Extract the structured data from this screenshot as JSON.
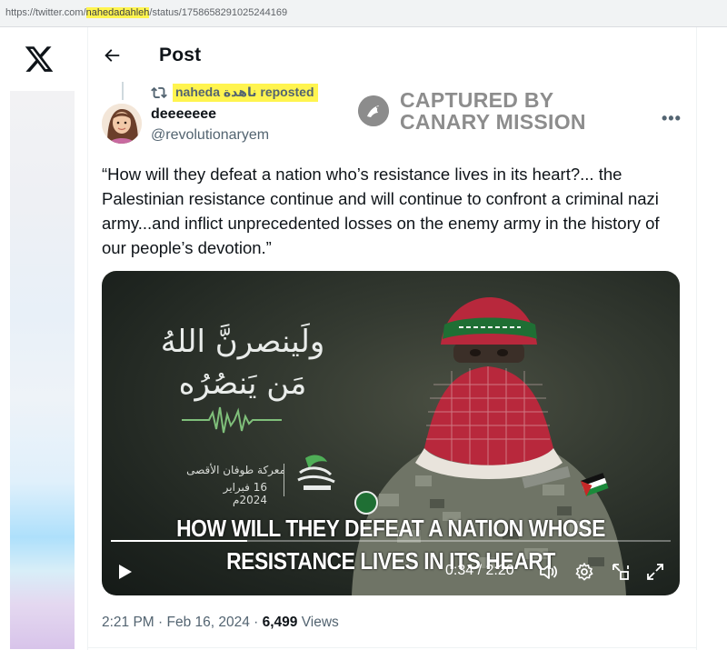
{
  "browser": {
    "url_prefix": "https://twitter.com/",
    "url_highlight": "nahedadahleh",
    "url_suffix": "/status/1758658291025244169"
  },
  "header": {
    "title": "Post"
  },
  "repost": {
    "label": "naheda ناهدة reposted"
  },
  "author": {
    "display_name": "deeeeeee",
    "handle": "@revolutionaryem"
  },
  "watermark": {
    "line1": "CAPTURED BY",
    "line2": "CANARY MISSION"
  },
  "tweet": {
    "text": "“How will they defeat a nation who’s resistance lives in its heart?... the Palestinian resistance continue and will continue to confront a criminal nazi army...and inflict unprecedented losses on the enemy army in the history of our people’s devotion.”"
  },
  "video": {
    "arabic_line1": "ولَينصرنَّ اللهُ",
    "arabic_line2": "مَن يَنصُرُه",
    "battle_name": "معركة طوفان الأقصى",
    "battle_date": "16 فبراير 2024م",
    "caption_line1": "HOW WILL THEY DEFEAT A NATION WHOSE",
    "caption_line2": "RESISTANCE LIVES IN ITS HEART",
    "time_display": "0:34 / 2:20",
    "progress_fraction": 0.243
  },
  "footer": {
    "timestamp": "2:21 PM · Feb 16, 2024 · ",
    "views_count": "6,499",
    "views_label": " Views"
  },
  "colors": {
    "highlight": "#fff44f",
    "secondary_text": "#536471",
    "primary_text": "#0f1419"
  }
}
